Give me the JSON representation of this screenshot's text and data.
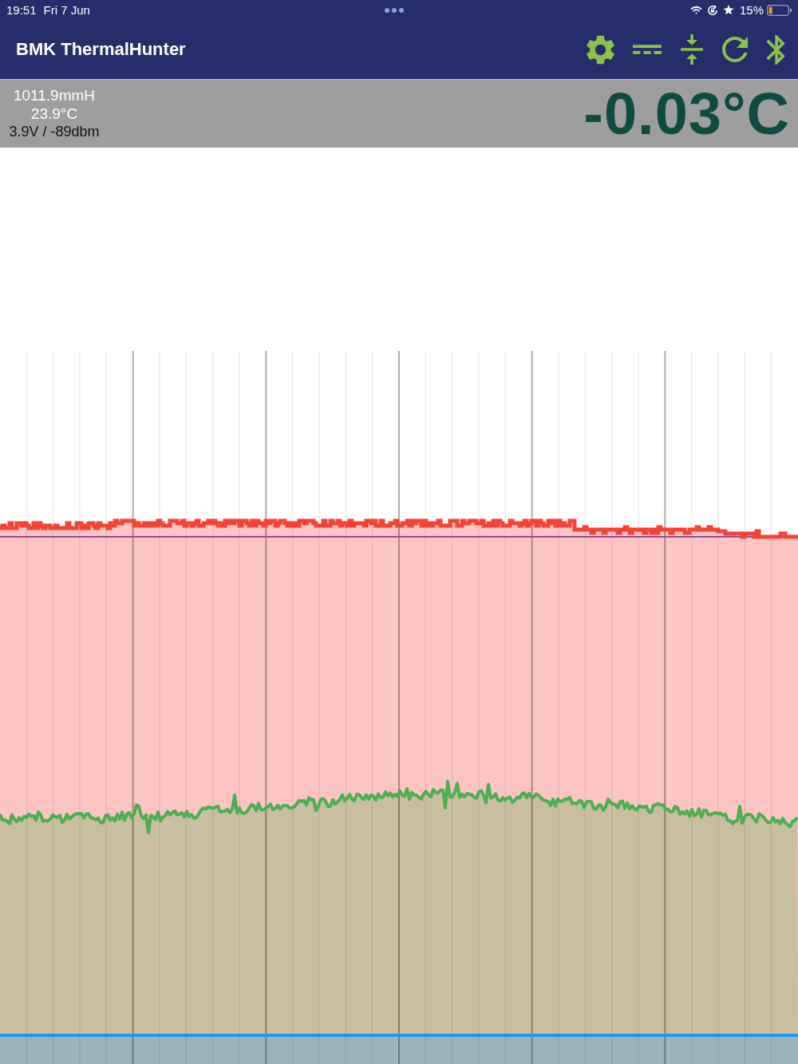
{
  "status_bar": {
    "time": "19:51",
    "date": "Fri 7 Jun",
    "battery": "15%"
  },
  "app_bar": {
    "title": "BMK ThermalHunter"
  },
  "readings": {
    "pressure": "1011.9mmH",
    "ambient": "23.9°C",
    "power": "3.9V / -89dbm",
    "temperature": "-0.03°C"
  }
}
